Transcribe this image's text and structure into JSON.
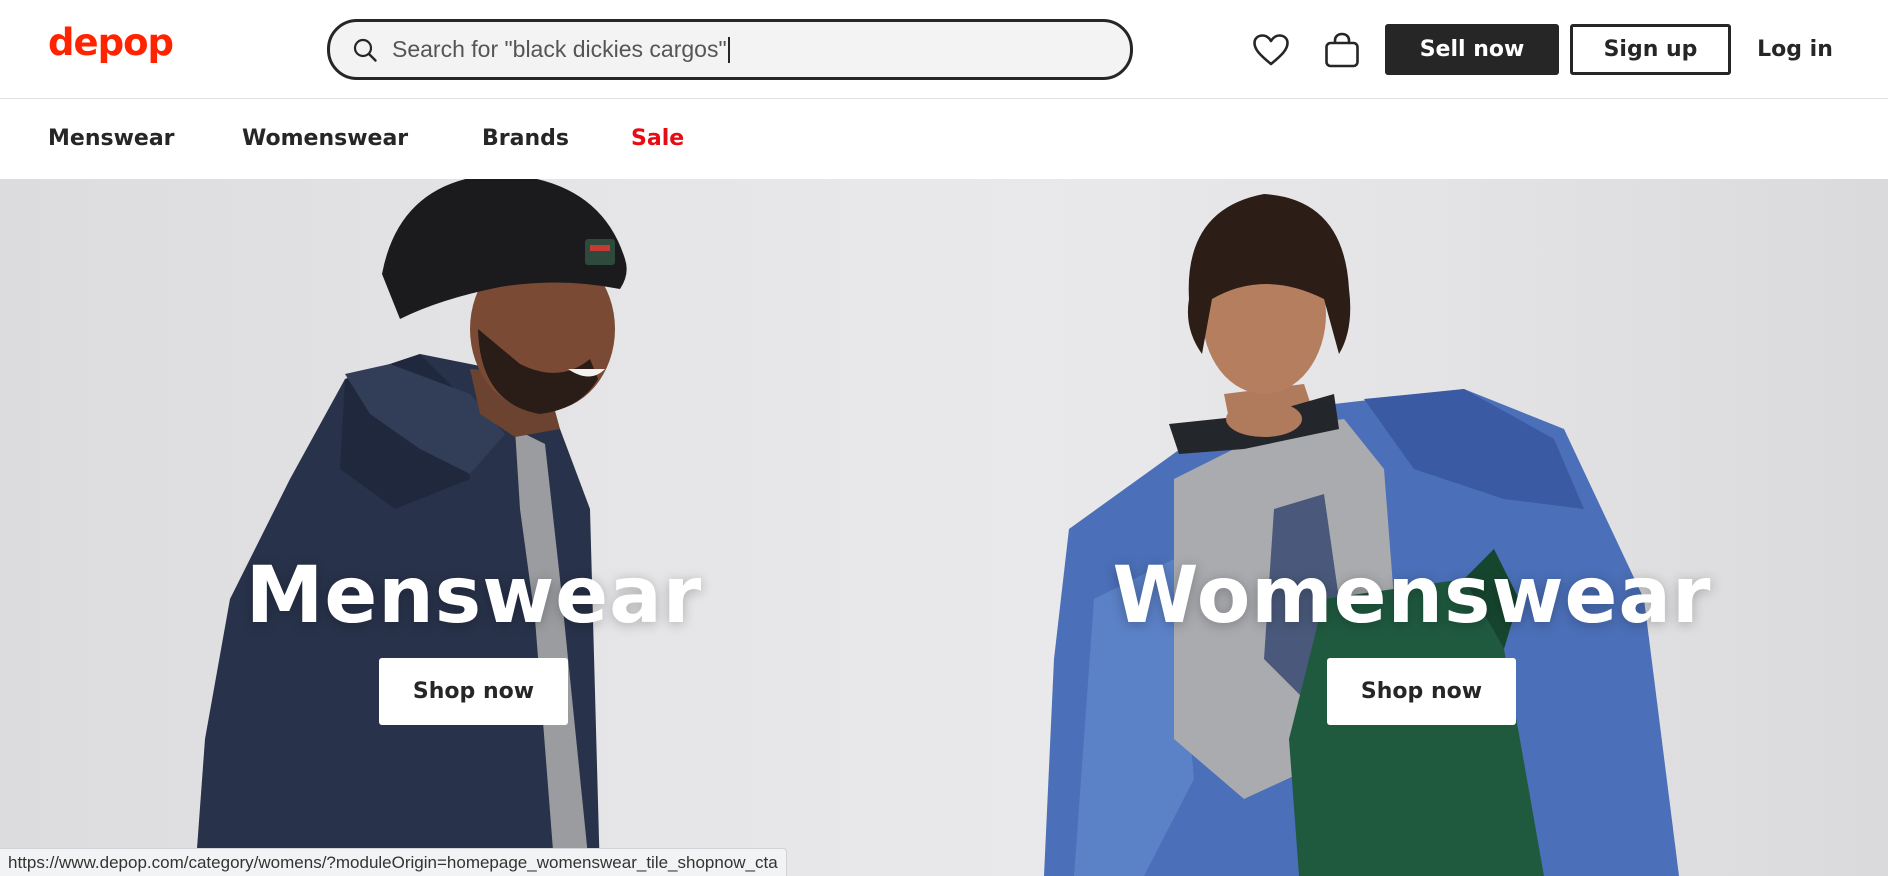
{
  "header": {
    "logo": "depop",
    "brand_color": "#ff2300",
    "search": {
      "value": "Search for \"black dickies cargos\"",
      "icon": "search-icon"
    },
    "icons": {
      "wishlist": "heart-icon",
      "bag": "shopping-bag-icon"
    },
    "sell_label": "Sell now",
    "signup_label": "Sign up",
    "login_label": "Log in"
  },
  "nav": {
    "items": [
      {
        "label": "Menswear"
      },
      {
        "label": "Womenswear"
      },
      {
        "label": "Brands"
      },
      {
        "label": "Sale",
        "color": "#e60b14"
      }
    ]
  },
  "hero": {
    "tiles": [
      {
        "title": "Menswear",
        "cta": "Shop now"
      },
      {
        "title": "Womenswear",
        "cta": "Shop now"
      }
    ]
  },
  "status_bar": {
    "url": "https://www.depop.com/category/womens/?moduleOrigin=homepage_womenswear_tile_shopnow_cta"
  }
}
